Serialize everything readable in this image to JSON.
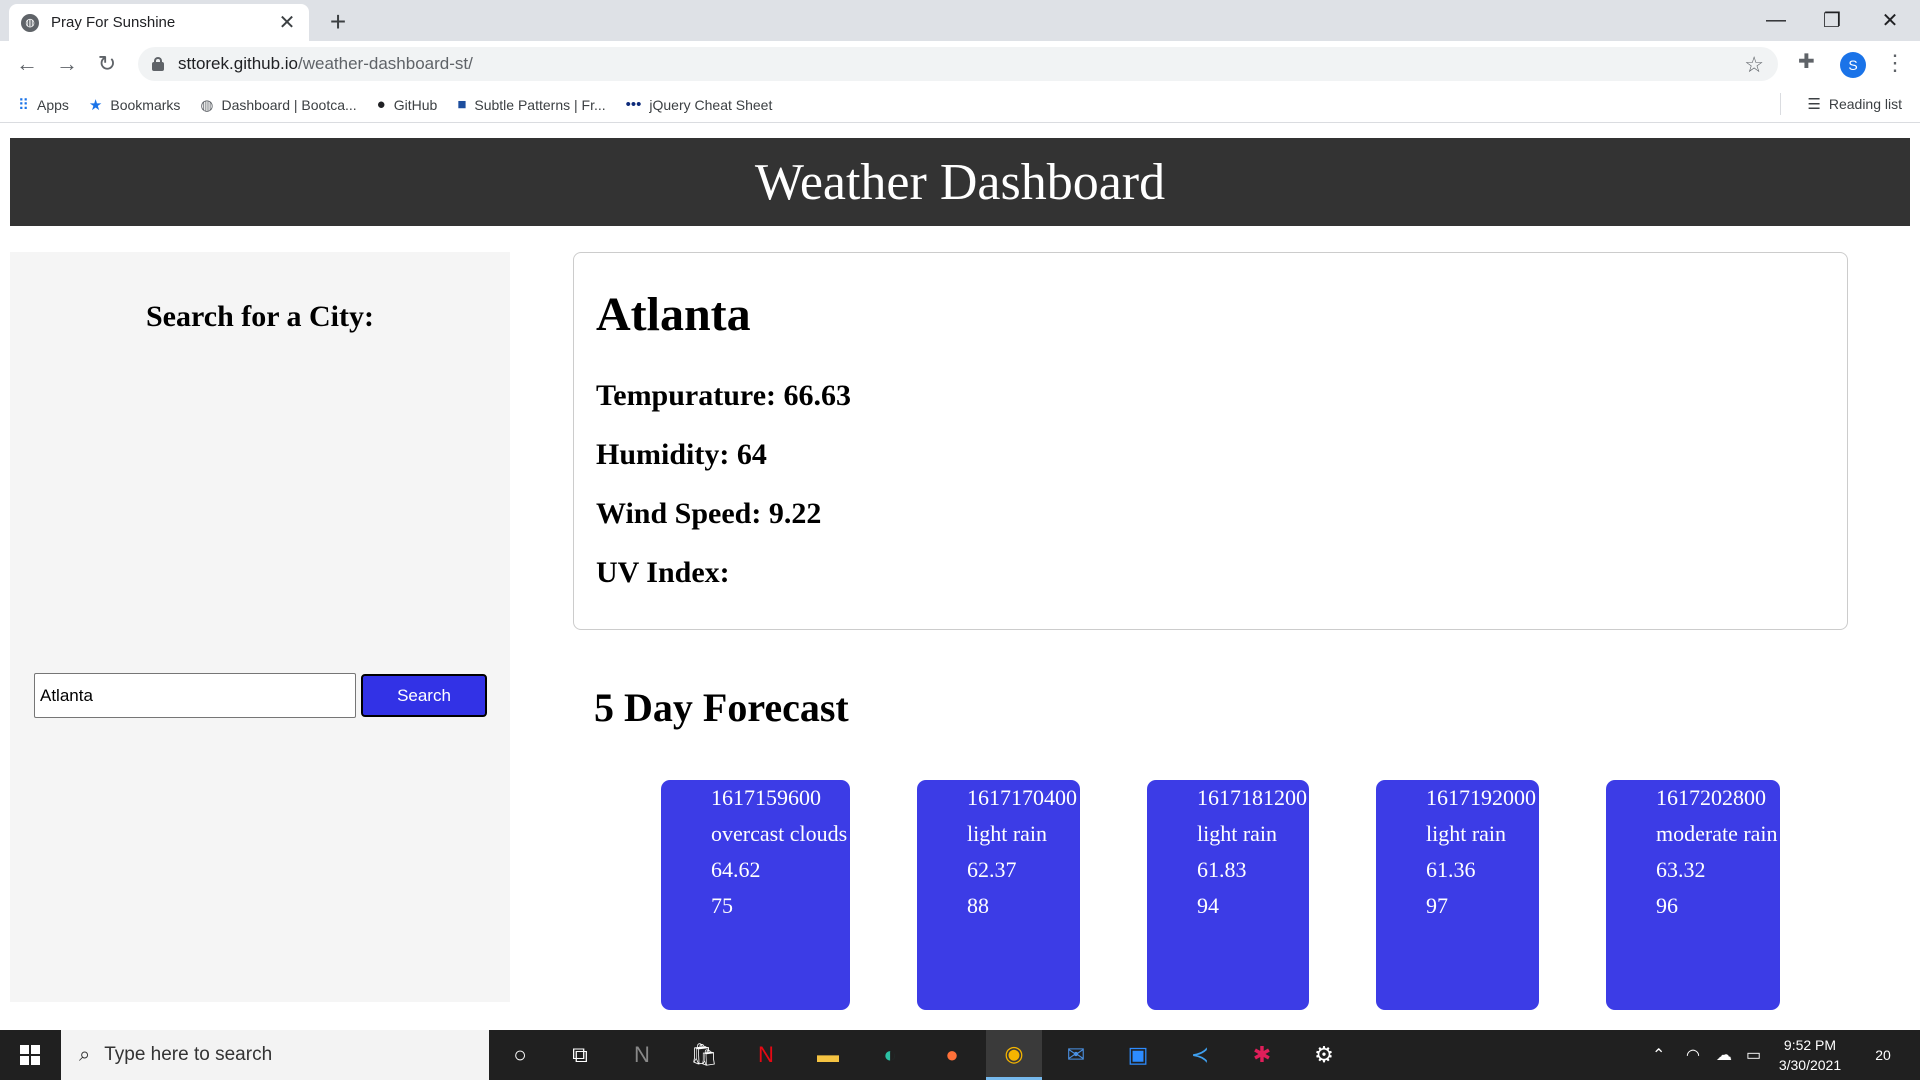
{
  "browser": {
    "tab_title": "Pray For Sunshine",
    "url_host": "sttorek.github.io",
    "url_path": "/weather-dashboard-st/",
    "profile_initial": "S",
    "bookmarks": [
      {
        "label": "Apps",
        "icon": "apps-grid-icon"
      },
      {
        "label": "Bookmarks",
        "icon": "star-icon"
      },
      {
        "label": "Dashboard | Bootca...",
        "icon": "globe-icon"
      },
      {
        "label": "GitHub",
        "icon": "github-icon"
      },
      {
        "label": "Subtle Patterns | Fr...",
        "icon": "subtle-patterns-icon"
      },
      {
        "label": "jQuery Cheat Sheet",
        "icon": "dots-icon"
      }
    ],
    "reading_list": "Reading list"
  },
  "page": {
    "header_title": "Weather Dashboard",
    "sidebar": {
      "heading": "Search for a City:",
      "input_value": "Atlanta",
      "search_label": "Search"
    },
    "current": {
      "city": "Atlanta",
      "temperature": "Tempurature: 66.63",
      "humidity": "Humidity: 64",
      "wind": "Wind Speed: 9.22",
      "uv": "UV Index:"
    },
    "forecast_title": "5 Day Forecast",
    "forecast": [
      {
        "time": "1617159600",
        "desc": "overcast clouds",
        "temp": "64.62",
        "humidity": "75"
      },
      {
        "time": "1617170400",
        "desc": "light rain",
        "temp": "62.37",
        "humidity": "88"
      },
      {
        "time": "1617181200",
        "desc": "light rain",
        "temp": "61.83",
        "humidity": "94"
      },
      {
        "time": "1617192000",
        "desc": "light rain",
        "temp": "61.36",
        "humidity": "97"
      },
      {
        "time": "1617202800",
        "desc": "moderate rain",
        "temp": "63.32",
        "humidity": "96"
      }
    ],
    "colors": {
      "header_bg": "#333333",
      "accent": "#3c3ce6",
      "sidebar_bg": "#f5f5f5"
    }
  },
  "taskbar": {
    "search_placeholder": "Type here to search",
    "time": "9:52 PM",
    "date": "3/30/2021",
    "notification_count": "20"
  }
}
